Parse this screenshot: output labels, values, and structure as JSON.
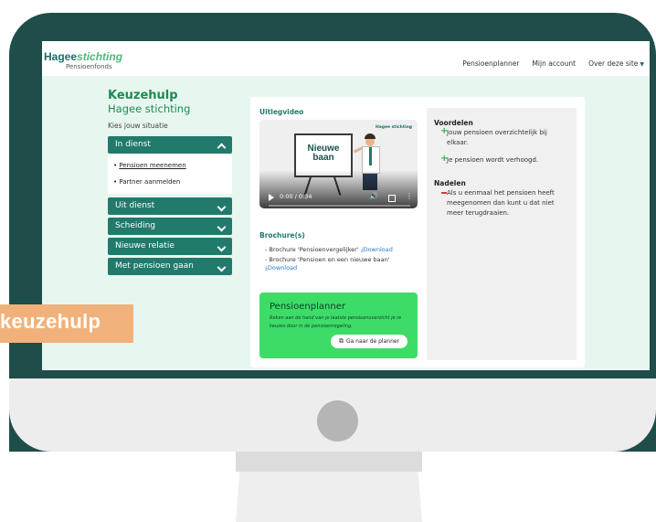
{
  "brand": {
    "logo_main": "Hagee",
    "logo_accent": "stichting",
    "logo_sub": "Pensioenfonds"
  },
  "nav": {
    "items": [
      "Pensioenplanner",
      "Mijn account",
      "Over deze site"
    ]
  },
  "keuzehulp": {
    "title": "Keuzehulp",
    "subtitle": "Hagee stichting",
    "choose_label": "Kies jouw situatie",
    "sections": [
      {
        "label": "In dienst",
        "open": true,
        "items": [
          "Pensioen meenemen",
          "Partner aanmelden"
        ]
      },
      {
        "label": "Uit dienst",
        "open": false
      },
      {
        "label": "Scheiding",
        "open": false
      },
      {
        "label": "Nieuwe relatie",
        "open": false
      },
      {
        "label": "Met pensioen gaan",
        "open": false
      }
    ]
  },
  "video": {
    "label": "Uitlegvideo",
    "board_text": "Nieuwe baan",
    "brand_text": "Hagee stichting",
    "time": "0:00 / 0:34",
    "progress": 0
  },
  "brochures": {
    "label": "Brochure(s)",
    "items": [
      {
        "text": "Brochure 'Pensioenvergelijker'",
        "link": "Download"
      },
      {
        "text": "Brochure 'Pensioen en een nieuwe baan'",
        "link": "Download"
      }
    ]
  },
  "planner": {
    "title": "Pensioenplanner",
    "description": "Reken aan de hand van je laatste pensioenoverzicht je re keuzes door in de pensioenregeling.",
    "button": "Ga naar de planner"
  },
  "voordelen": {
    "title": "Voordelen",
    "items": [
      "Jouw pensioen overzichtelijk bij elkaar.",
      "Je pensioen wordt verhoogd."
    ]
  },
  "nadelen": {
    "title": "Nadelen",
    "items": [
      "Als u eenmaal het pensioen heeft meegenomen dan kunt u dat niet meer terugdraaien."
    ]
  },
  "banner": {
    "text": "keuzehulp"
  },
  "colors": {
    "accent": "#217a6b",
    "green_cta": "#3ddc67",
    "banner": "#f0b27a",
    "screen_bg": "#e7f7ef",
    "monitor": "#1f4d4a"
  }
}
